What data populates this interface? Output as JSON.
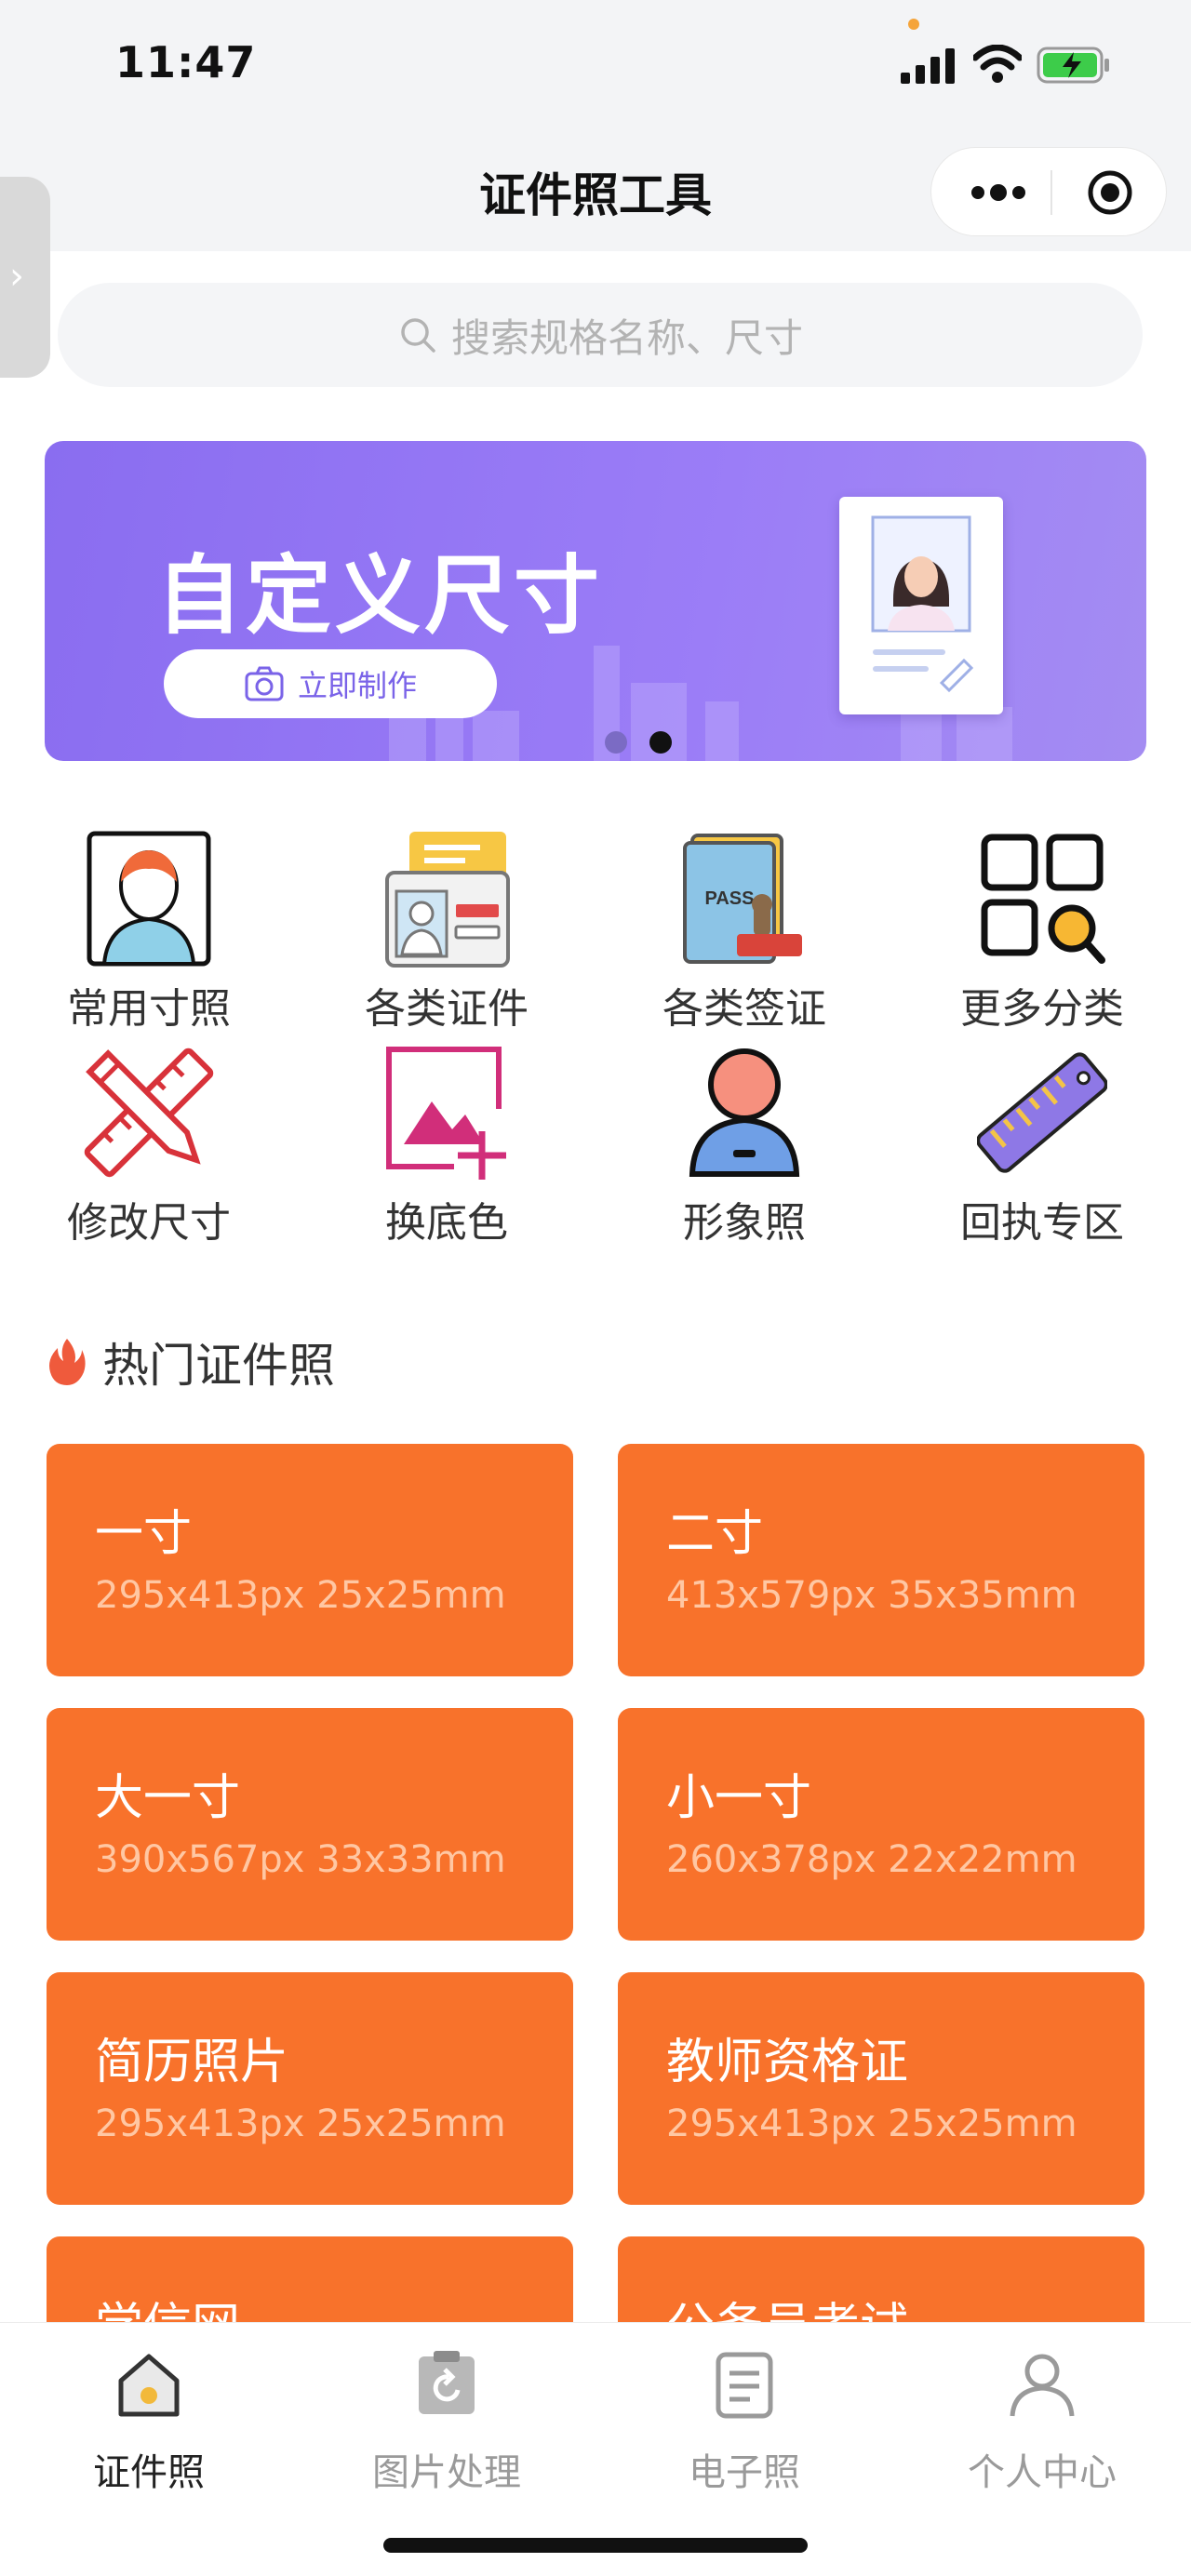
{
  "status": {
    "time": "11:47"
  },
  "header": {
    "title": "证件照工具"
  },
  "search": {
    "placeholder": "搜索规格名称、尺寸"
  },
  "banner": {
    "title": "自定义尺寸",
    "button_label": "立即制作",
    "pager": {
      "count": 2,
      "active": 2
    }
  },
  "categories": [
    {
      "label": "常用寸照",
      "icon": "portrait-frame-icon"
    },
    {
      "label": "各类证件",
      "icon": "id-card-folder-icon"
    },
    {
      "label": "各类签证",
      "icon": "passport-stamp-icon"
    },
    {
      "label": "更多分类",
      "icon": "grid-search-icon"
    },
    {
      "label": "修改尺寸",
      "icon": "pencil-ruler-icon"
    },
    {
      "label": "换底色",
      "icon": "image-add-icon"
    },
    {
      "label": "形象照",
      "icon": "person-avatar-icon"
    },
    {
      "label": "回执专区",
      "icon": "ruler-icon"
    }
  ],
  "hot": {
    "title": "热门证件照",
    "items": [
      {
        "name": "一寸",
        "spec": "295x413px 25x25mm"
      },
      {
        "name": "二寸",
        "spec": "413x579px 35x35mm"
      },
      {
        "name": "大一寸",
        "spec": "390x567px 33x33mm"
      },
      {
        "name": "小一寸",
        "spec": "260x378px 22x22mm"
      },
      {
        "name": "简历照片",
        "spec": "295x413px 25x25mm"
      },
      {
        "name": "教师资格证",
        "spec": "295x413px 25x25mm"
      },
      {
        "name": "学信网",
        "spec": ""
      },
      {
        "name": "公务员考试",
        "spec": ""
      }
    ]
  },
  "tabbar": {
    "items": [
      {
        "label": "证件照",
        "icon": "home-icon",
        "active": true
      },
      {
        "label": "图片处理",
        "icon": "image-process-icon",
        "active": false
      },
      {
        "label": "电子照",
        "icon": "document-icon",
        "active": false
      },
      {
        "label": "个人中心",
        "icon": "user-icon",
        "active": false
      }
    ]
  },
  "colors": {
    "accent": "#f8722b",
    "banner": "#8f72f3",
    "bg": "#f3f4f6"
  }
}
